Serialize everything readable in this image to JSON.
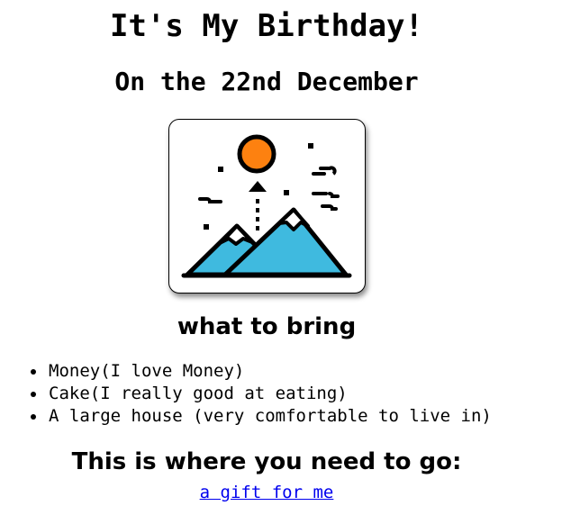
{
  "header": {
    "title": "It's My Birthday!",
    "date": "On the 22nd December"
  },
  "image": {
    "icon": "mountain-landscape-icon",
    "colors": {
      "sun": "#fd8110",
      "mountain": "#3fbadf",
      "outline": "#000000"
    }
  },
  "bring": {
    "heading": "what to bring",
    "items": [
      "Money(I love Money)",
      "Cake(I really good at eating)",
      "A large house (very comfortable to live in)"
    ]
  },
  "location": {
    "heading": "This is where you need to go:",
    "link_text": "a gift for me",
    "link_color": "#0000ee"
  }
}
